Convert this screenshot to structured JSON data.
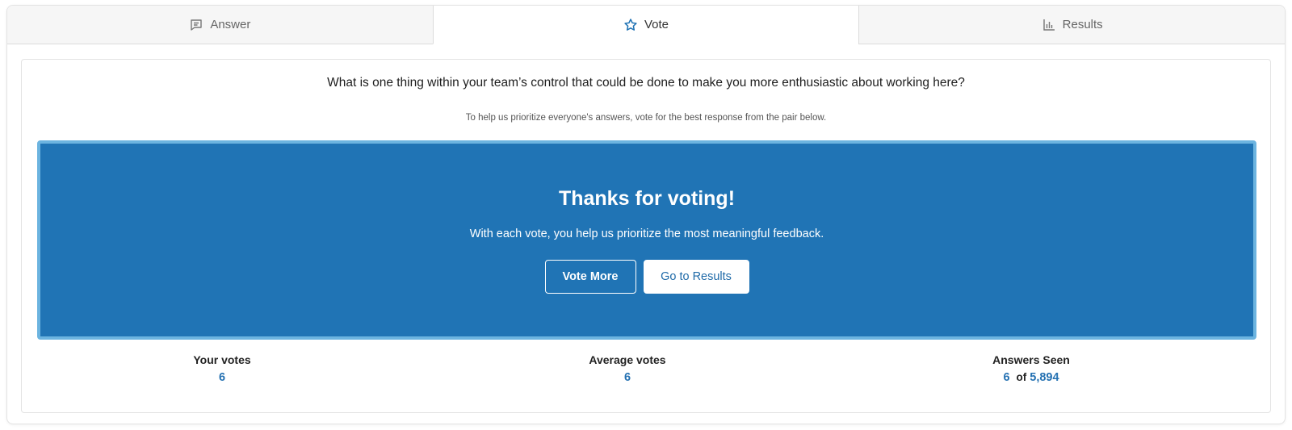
{
  "tabs": [
    {
      "label": "Answer",
      "icon": "chat-bubble-icon",
      "active": false
    },
    {
      "label": "Vote",
      "icon": "star-icon",
      "active": true
    },
    {
      "label": "Results",
      "icon": "bar-chart-icon",
      "active": false
    }
  ],
  "question": "What is one thing within your team’s control that could be done to make you more enthusiastic about working here?",
  "hint": "To help us prioritize everyone's answers, vote for the best response from the pair below.",
  "banner": {
    "title": "Thanks for voting!",
    "subtitle": "With each vote, you help us prioritize the most meaningful feedback.",
    "vote_more_label": "Vote More",
    "results_label": "Go to Results"
  },
  "stats": {
    "your_votes": {
      "label": "Your votes",
      "value": "6"
    },
    "average_votes": {
      "label": "Average votes",
      "value": "6"
    },
    "answers_seen": {
      "label": "Answers Seen",
      "value": "6",
      "of_label": "of",
      "total": "5,894"
    }
  },
  "colors": {
    "accent": "#2074b5",
    "banner_border": "#6cb4e0",
    "link": "#2471b2"
  }
}
